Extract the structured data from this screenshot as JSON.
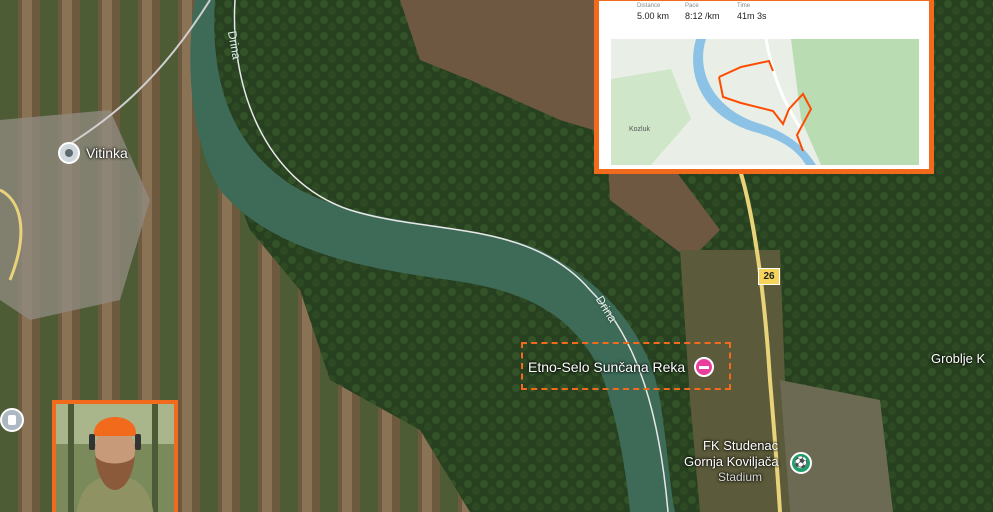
{
  "map": {
    "places": {
      "vitinka": "Vitinka",
      "etno_selo": "Etno-Selo Sunčana Reka",
      "fk_studenac_line1": "FK Studenac",
      "fk_studenac_line2": "Gornja Koviljača",
      "fk_studenac_line3": "Stadium",
      "groblje": "Groblje K"
    },
    "river_labels": [
      "Drina",
      "Drina"
    ],
    "road_number": "26",
    "colors": {
      "highlight": "#f26b1d",
      "poi_pink": "#e83e9c",
      "poi_green": "#1e9e6a",
      "river": "#3d6b58"
    }
  },
  "activity_inset": {
    "stats": [
      {
        "label": "Distance",
        "value": "5.00 km"
      },
      {
        "label": "Pace",
        "value": "8:12 /km"
      },
      {
        "label": "Time",
        "value": "41m 3s"
      }
    ],
    "map_place": "Kozluk",
    "route_color": "#fc4c02"
  }
}
